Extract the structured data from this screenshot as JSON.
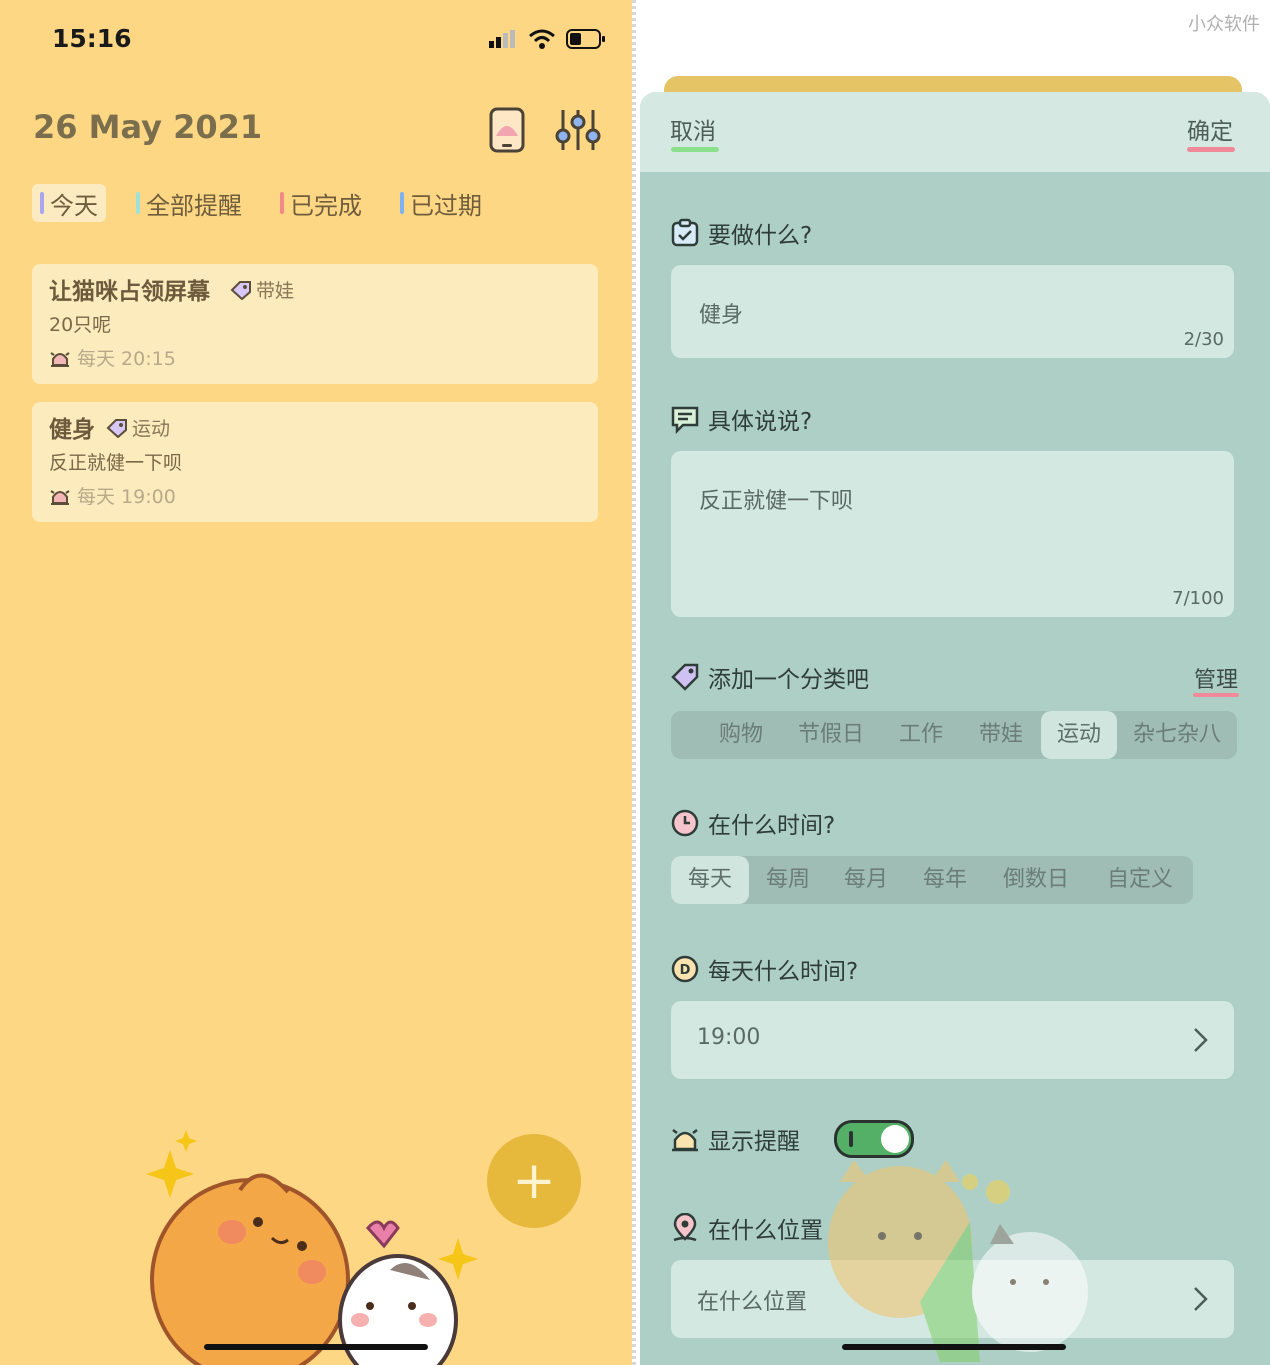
{
  "left": {
    "status": {
      "time": "15:16"
    },
    "header": {
      "date": "26 May 2021",
      "icons": [
        "phone-widget-icon",
        "filter-sliders-icon"
      ]
    },
    "tabs": [
      {
        "label": "今天",
        "color": "#a8a6f0",
        "active": true
      },
      {
        "label": "全部提醒",
        "color": "#9fe0d8",
        "active": false
      },
      {
        "label": "已完成",
        "color": "#f28a8a",
        "active": false
      },
      {
        "label": "已过期",
        "color": "#7fb2f2",
        "active": false
      }
    ],
    "cards": [
      {
        "title": "让猫咪占领屏幕",
        "tag": "带娃",
        "note": "20只呢",
        "remind": "每天 20:15"
      },
      {
        "title": "健身",
        "tag": "运动",
        "note": "反正就健一下呗",
        "remind": "每天 19:00"
      }
    ],
    "fab": {
      "label": "+"
    }
  },
  "right": {
    "watermark": "小众软件",
    "header": {
      "cancel": "取消",
      "confirm": "确定"
    },
    "what": {
      "label": "要做什么?",
      "value": "健身",
      "count": "2/30"
    },
    "detail": {
      "label": "具体说说?",
      "value": "反正就健一下呗",
      "count": "7/100"
    },
    "category": {
      "label": "添加一个分类吧",
      "manage": "管理",
      "options": [
        "购物",
        "节假日",
        "工作",
        "带娃",
        "运动",
        "杂七杂八"
      ],
      "selected": "运动"
    },
    "time": {
      "label": "在什么时间?",
      "options": [
        "每天",
        "每周",
        "每月",
        "每年",
        "倒数日",
        "自定义"
      ],
      "selected": "每天"
    },
    "daily": {
      "label": "每天什么时间?",
      "value": "19:00"
    },
    "reminder": {
      "label": "显示提醒",
      "on": true
    },
    "location": {
      "label": "在什么位置",
      "placeholder": "在什么位置"
    }
  }
}
